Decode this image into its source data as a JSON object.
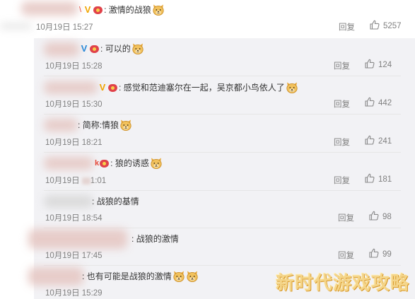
{
  "watermark": "新时代游戏攻略",
  "labels": {
    "reply": "回复"
  },
  "top_comment": {
    "text": "激情的战狼",
    "date": "10月19日 15:27",
    "likes": "5257"
  },
  "replies": [
    {
      "text": "可以的",
      "date": "10月19日 15:28",
      "likes": "124",
      "badge": "blue-v"
    },
    {
      "text": "感觉和范迪塞尔在一起，吴京都小鸟依人了",
      "date": "10月19日 15:30",
      "likes": "442",
      "badge": "gold-v"
    },
    {
      "text": "简称:情狼",
      "date": "10月19日 18:21",
      "likes": "241",
      "badge": "none"
    },
    {
      "text": "狼的诱惑",
      "date": "10月19日 ",
      "date_tail": ":01",
      "date_mid": "1",
      "likes": "181",
      "badge": "k"
    },
    {
      "text": "战狼的基情",
      "date": "10月19日 18:54",
      "likes": "98",
      "badge": "none"
    },
    {
      "text": "战狼的激情",
      "date": "10月19日 17:45",
      "likes": "99",
      "badge": "none"
    },
    {
      "text": "也有可能是战狼的激情",
      "date": "10月19日 15:29",
      "likes": "",
      "badge": "none"
    }
  ],
  "icons": {
    "like": "thumbs-up-icon",
    "emoji": "doge-emoji-icon"
  },
  "colors": {
    "panel": "#f2f2f5",
    "meta": "#808080",
    "gold_v": "#f0a500",
    "blue_v": "#2a8ad8"
  }
}
